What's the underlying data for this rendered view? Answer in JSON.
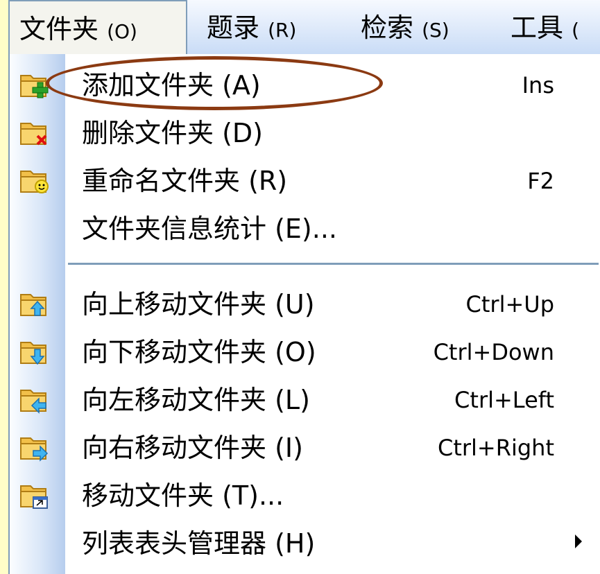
{
  "menubar": {
    "items": [
      {
        "label": "文件夹 ",
        "accel": "(O)"
      },
      {
        "label": "题录 ",
        "accel": "(R)"
      },
      {
        "label": "检索 ",
        "accel": "(S)"
      },
      {
        "label": "工具 ",
        "accel": "("
      }
    ]
  },
  "menu": {
    "items": [
      {
        "label": "添加文件夹 (A)",
        "shortcut": "Ins",
        "icon": "folder-add-icon"
      },
      {
        "label": "删除文件夹 (D)",
        "shortcut": "",
        "icon": "folder-delete-icon"
      },
      {
        "label": "重命名文件夹 (R)",
        "shortcut": "F2",
        "icon": "folder-rename-icon"
      },
      {
        "label": "文件夹信息统计 (E)...",
        "shortcut": "",
        "icon": ""
      },
      {
        "label": "向上移动文件夹 (U)",
        "shortcut": "Ctrl+Up",
        "icon": "folder-move-up-icon"
      },
      {
        "label": "向下移动文件夹 (O)",
        "shortcut": "Ctrl+Down",
        "icon": "folder-move-down-icon"
      },
      {
        "label": "向左移动文件夹 (L)",
        "shortcut": "Ctrl+Left",
        "icon": "folder-move-left-icon"
      },
      {
        "label": "向右移动文件夹 (I)",
        "shortcut": "Ctrl+Right",
        "icon": "folder-move-right-icon"
      },
      {
        "label": "移动文件夹 (T)...",
        "shortcut": "",
        "icon": "folder-move-icon"
      },
      {
        "label": "列表表头管理器 (H)",
        "shortcut": "",
        "icon": "",
        "submenu": true
      }
    ]
  },
  "colors": {
    "background": "#fffec8",
    "highlight_ellipse": "#8b3a12",
    "separator": "#7f9db9"
  }
}
